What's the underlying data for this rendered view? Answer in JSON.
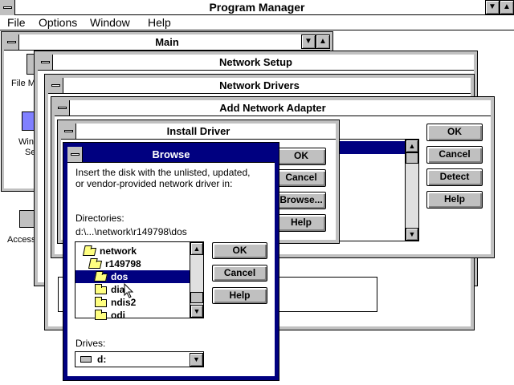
{
  "program_manager": {
    "title": "Program Manager",
    "menu": [
      "File",
      "Options",
      "Window",
      "Help"
    ]
  },
  "main_group": {
    "title": "Main",
    "icon_labels": [
      "File Ma",
      "Windo",
      "Se",
      "Access"
    ]
  },
  "network_setup": {
    "title": "Network Setup"
  },
  "network_drivers": {
    "title": "Network Drivers"
  },
  "add_network_adapter": {
    "title": "Add Network Adapter",
    "buttons": [
      "OK",
      "Cancel",
      "Detect",
      "Help"
    ]
  },
  "install_driver": {
    "title": "Install Driver",
    "buttons": [
      "OK",
      "Cancel",
      "Browse...",
      "Help"
    ]
  },
  "browse": {
    "title": "Browse",
    "instruction_line1": "Insert the disk with the unlisted, updated,",
    "instruction_line2": "or vendor-provided network driver in:",
    "directories_label": "Directories:",
    "current_path": "d:\\...\\network\\r149798\\dos",
    "directories": [
      "network",
      "r149798",
      "dos",
      "dia",
      "ndis2",
      "odi"
    ],
    "selected_directory": "dos",
    "drives_label": "Drives:",
    "drive_value": "d:",
    "buttons": [
      "OK",
      "Cancel",
      "Help"
    ]
  }
}
